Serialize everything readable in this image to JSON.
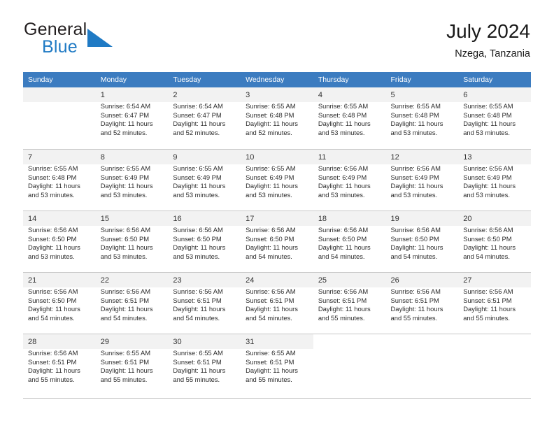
{
  "brand": {
    "name_part1": "General",
    "name_part2": "Blue",
    "logo_icon": "triangle-flag-icon",
    "accent_color": "#1f7ac4"
  },
  "header": {
    "title": "July 2024",
    "location": "Nzega, Tanzania"
  },
  "calendar": {
    "header_bg_color": "#3c7cc0",
    "daynum_strip_color": "#f2f2f2",
    "weekday_headers": [
      "Sunday",
      "Monday",
      "Tuesday",
      "Wednesday",
      "Thursday",
      "Friday",
      "Saturday"
    ],
    "weeks": [
      [
        {
          "day": "",
          "sunrise": "",
          "sunset": "",
          "daylight_line1": "",
          "daylight_line2": ""
        },
        {
          "day": "1",
          "sunrise": "Sunrise: 6:54 AM",
          "sunset": "Sunset: 6:47 PM",
          "daylight_line1": "Daylight: 11 hours",
          "daylight_line2": "and 52 minutes."
        },
        {
          "day": "2",
          "sunrise": "Sunrise: 6:54 AM",
          "sunset": "Sunset: 6:47 PM",
          "daylight_line1": "Daylight: 11 hours",
          "daylight_line2": "and 52 minutes."
        },
        {
          "day": "3",
          "sunrise": "Sunrise: 6:55 AM",
          "sunset": "Sunset: 6:48 PM",
          "daylight_line1": "Daylight: 11 hours",
          "daylight_line2": "and 52 minutes."
        },
        {
          "day": "4",
          "sunrise": "Sunrise: 6:55 AM",
          "sunset": "Sunset: 6:48 PM",
          "daylight_line1": "Daylight: 11 hours",
          "daylight_line2": "and 53 minutes."
        },
        {
          "day": "5",
          "sunrise": "Sunrise: 6:55 AM",
          "sunset": "Sunset: 6:48 PM",
          "daylight_line1": "Daylight: 11 hours",
          "daylight_line2": "and 53 minutes."
        },
        {
          "day": "6",
          "sunrise": "Sunrise: 6:55 AM",
          "sunset": "Sunset: 6:48 PM",
          "daylight_line1": "Daylight: 11 hours",
          "daylight_line2": "and 53 minutes."
        }
      ],
      [
        {
          "day": "7",
          "sunrise": "Sunrise: 6:55 AM",
          "sunset": "Sunset: 6:48 PM",
          "daylight_line1": "Daylight: 11 hours",
          "daylight_line2": "and 53 minutes."
        },
        {
          "day": "8",
          "sunrise": "Sunrise: 6:55 AM",
          "sunset": "Sunset: 6:49 PM",
          "daylight_line1": "Daylight: 11 hours",
          "daylight_line2": "and 53 minutes."
        },
        {
          "day": "9",
          "sunrise": "Sunrise: 6:55 AM",
          "sunset": "Sunset: 6:49 PM",
          "daylight_line1": "Daylight: 11 hours",
          "daylight_line2": "and 53 minutes."
        },
        {
          "day": "10",
          "sunrise": "Sunrise: 6:55 AM",
          "sunset": "Sunset: 6:49 PM",
          "daylight_line1": "Daylight: 11 hours",
          "daylight_line2": "and 53 minutes."
        },
        {
          "day": "11",
          "sunrise": "Sunrise: 6:56 AM",
          "sunset": "Sunset: 6:49 PM",
          "daylight_line1": "Daylight: 11 hours",
          "daylight_line2": "and 53 minutes."
        },
        {
          "day": "12",
          "sunrise": "Sunrise: 6:56 AM",
          "sunset": "Sunset: 6:49 PM",
          "daylight_line1": "Daylight: 11 hours",
          "daylight_line2": "and 53 minutes."
        },
        {
          "day": "13",
          "sunrise": "Sunrise: 6:56 AM",
          "sunset": "Sunset: 6:49 PM",
          "daylight_line1": "Daylight: 11 hours",
          "daylight_line2": "and 53 minutes."
        }
      ],
      [
        {
          "day": "14",
          "sunrise": "Sunrise: 6:56 AM",
          "sunset": "Sunset: 6:50 PM",
          "daylight_line1": "Daylight: 11 hours",
          "daylight_line2": "and 53 minutes."
        },
        {
          "day": "15",
          "sunrise": "Sunrise: 6:56 AM",
          "sunset": "Sunset: 6:50 PM",
          "daylight_line1": "Daylight: 11 hours",
          "daylight_line2": "and 53 minutes."
        },
        {
          "day": "16",
          "sunrise": "Sunrise: 6:56 AM",
          "sunset": "Sunset: 6:50 PM",
          "daylight_line1": "Daylight: 11 hours",
          "daylight_line2": "and 53 minutes."
        },
        {
          "day": "17",
          "sunrise": "Sunrise: 6:56 AM",
          "sunset": "Sunset: 6:50 PM",
          "daylight_line1": "Daylight: 11 hours",
          "daylight_line2": "and 54 minutes."
        },
        {
          "day": "18",
          "sunrise": "Sunrise: 6:56 AM",
          "sunset": "Sunset: 6:50 PM",
          "daylight_line1": "Daylight: 11 hours",
          "daylight_line2": "and 54 minutes."
        },
        {
          "day": "19",
          "sunrise": "Sunrise: 6:56 AM",
          "sunset": "Sunset: 6:50 PM",
          "daylight_line1": "Daylight: 11 hours",
          "daylight_line2": "and 54 minutes."
        },
        {
          "day": "20",
          "sunrise": "Sunrise: 6:56 AM",
          "sunset": "Sunset: 6:50 PM",
          "daylight_line1": "Daylight: 11 hours",
          "daylight_line2": "and 54 minutes."
        }
      ],
      [
        {
          "day": "21",
          "sunrise": "Sunrise: 6:56 AM",
          "sunset": "Sunset: 6:50 PM",
          "daylight_line1": "Daylight: 11 hours",
          "daylight_line2": "and 54 minutes."
        },
        {
          "day": "22",
          "sunrise": "Sunrise: 6:56 AM",
          "sunset": "Sunset: 6:51 PM",
          "daylight_line1": "Daylight: 11 hours",
          "daylight_line2": "and 54 minutes."
        },
        {
          "day": "23",
          "sunrise": "Sunrise: 6:56 AM",
          "sunset": "Sunset: 6:51 PM",
          "daylight_line1": "Daylight: 11 hours",
          "daylight_line2": "and 54 minutes."
        },
        {
          "day": "24",
          "sunrise": "Sunrise: 6:56 AM",
          "sunset": "Sunset: 6:51 PM",
          "daylight_line1": "Daylight: 11 hours",
          "daylight_line2": "and 54 minutes."
        },
        {
          "day": "25",
          "sunrise": "Sunrise: 6:56 AM",
          "sunset": "Sunset: 6:51 PM",
          "daylight_line1": "Daylight: 11 hours",
          "daylight_line2": "and 55 minutes."
        },
        {
          "day": "26",
          "sunrise": "Sunrise: 6:56 AM",
          "sunset": "Sunset: 6:51 PM",
          "daylight_line1": "Daylight: 11 hours",
          "daylight_line2": "and 55 minutes."
        },
        {
          "day": "27",
          "sunrise": "Sunrise: 6:56 AM",
          "sunset": "Sunset: 6:51 PM",
          "daylight_line1": "Daylight: 11 hours",
          "daylight_line2": "and 55 minutes."
        }
      ],
      [
        {
          "day": "28",
          "sunrise": "Sunrise: 6:56 AM",
          "sunset": "Sunset: 6:51 PM",
          "daylight_line1": "Daylight: 11 hours",
          "daylight_line2": "and 55 minutes."
        },
        {
          "day": "29",
          "sunrise": "Sunrise: 6:55 AM",
          "sunset": "Sunset: 6:51 PM",
          "daylight_line1": "Daylight: 11 hours",
          "daylight_line2": "and 55 minutes."
        },
        {
          "day": "30",
          "sunrise": "Sunrise: 6:55 AM",
          "sunset": "Sunset: 6:51 PM",
          "daylight_line1": "Daylight: 11 hours",
          "daylight_line2": "and 55 minutes."
        },
        {
          "day": "31",
          "sunrise": "Sunrise: 6:55 AM",
          "sunset": "Sunset: 6:51 PM",
          "daylight_line1": "Daylight: 11 hours",
          "daylight_line2": "and 55 minutes."
        },
        {
          "day": "",
          "sunrise": "",
          "sunset": "",
          "daylight_line1": "",
          "daylight_line2": ""
        },
        {
          "day": "",
          "sunrise": "",
          "sunset": "",
          "daylight_line1": "",
          "daylight_line2": ""
        },
        {
          "day": "",
          "sunrise": "",
          "sunset": "",
          "daylight_line1": "",
          "daylight_line2": ""
        }
      ]
    ]
  }
}
